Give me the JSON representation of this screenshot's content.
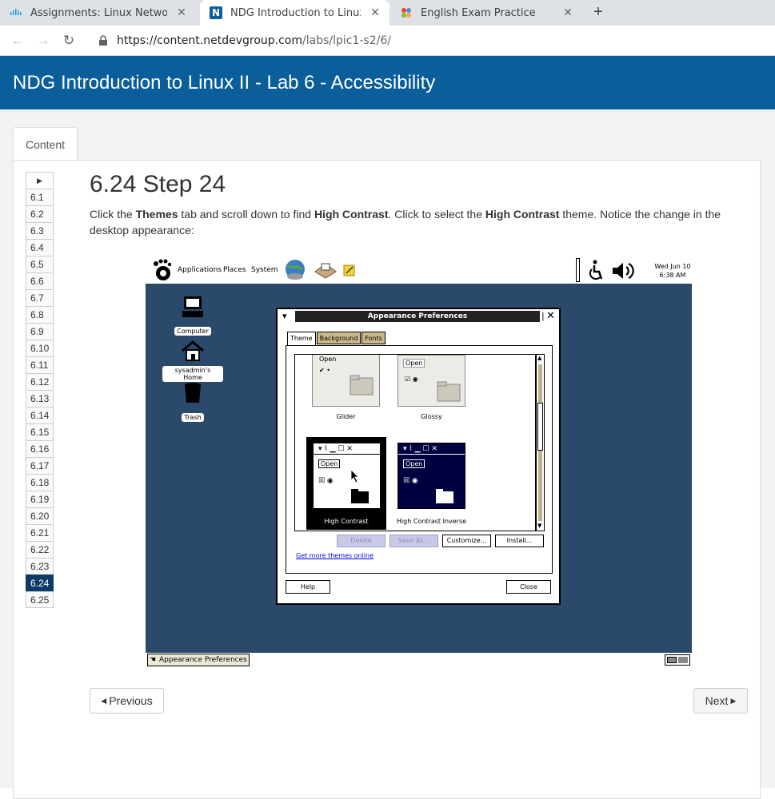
{
  "browser": {
    "tabs": [
      {
        "title": "Assignments: Linux Networking",
        "icon": "cisco-icon",
        "active": false
      },
      {
        "title": "NDG Introduction to Linux II - La",
        "icon": "ndg-icon",
        "active": true
      },
      {
        "title": "English Exam Practice",
        "icon": "joomla-icon",
        "active": false
      }
    ],
    "url_host": "https://content.netdevgroup.com",
    "url_path": "/labs/lpic1-s2/6/"
  },
  "page": {
    "banner_title": "NDG Introduction to Linux II - Lab 6 - Accessibility",
    "content_tab": "Content",
    "steps": [
      "6.1",
      "6.2",
      "6.3",
      "6.4",
      "6.5",
      "6.6",
      "6.7",
      "6.8",
      "6.9",
      "6.10",
      "6.11",
      "6.12",
      "6.13",
      "6.14",
      "6.15",
      "6.16",
      "6.17",
      "6.18",
      "6.19",
      "6.20",
      "6.21",
      "6.22",
      "6.23",
      "6.24",
      "6.25"
    ],
    "active_step": "6.24",
    "step_title": "6.24 Step 24",
    "instruction": {
      "t1": "Click the ",
      "b1": "Themes",
      "t2": " tab and scroll down to find ",
      "b2": "High Contrast",
      "t3": ". Click to select the ",
      "b3": "High Contrast",
      "t4": " theme. Notice the change in the desktop appearance:"
    },
    "prev_label": "Previous",
    "next_label": "Next"
  },
  "desktop": {
    "menus": [
      "Applications",
      "Places",
      "System"
    ],
    "clock_day": "Wed Jun 10",
    "clock_time": "6:38 AM",
    "icons": [
      "Computer",
      "sysadmin's Home",
      "Trash"
    ],
    "taskbar_item": "Appearance Preferences",
    "dialog": {
      "title": "Appearance Preferences",
      "tabs": [
        "Theme",
        "Background",
        "Fonts"
      ],
      "themes": [
        "Glider",
        "Glossy",
        "High Contrast",
        "High Contrast Inverse"
      ],
      "preview_open": "Open",
      "selected_theme": "High Contrast",
      "buttons": [
        "Delete",
        "Save As...",
        "Customize...",
        "Install..."
      ],
      "link": "Get more themes online",
      "help": "Help",
      "close": "Close"
    }
  }
}
